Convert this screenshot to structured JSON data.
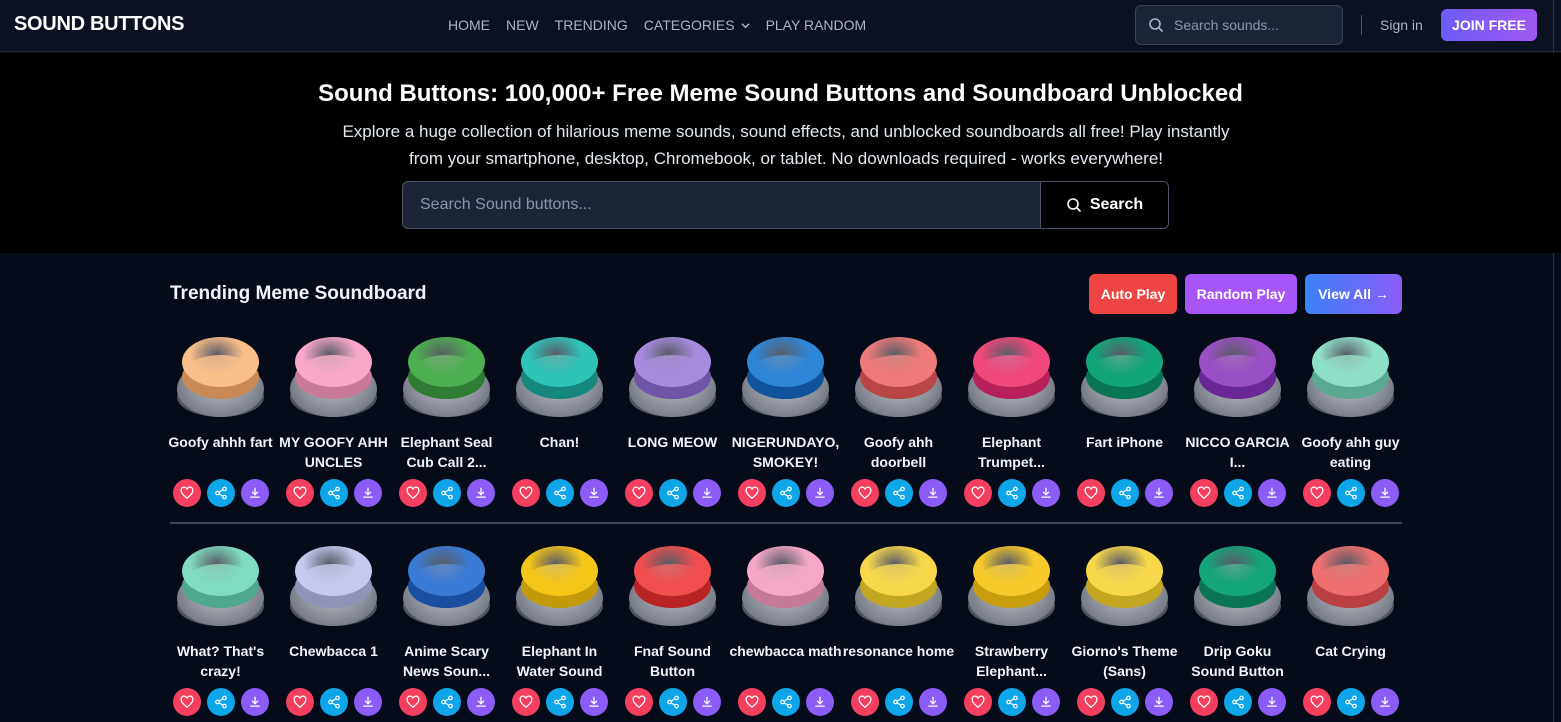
{
  "header": {
    "logo": "SOUND BUTTONS",
    "nav": [
      {
        "label": "HOME"
      },
      {
        "label": "NEW"
      },
      {
        "label": "TRENDING"
      },
      {
        "label": "CATEGORIES"
      },
      {
        "label": "PLAY RANDOM"
      }
    ],
    "search_placeholder": "Search sounds...",
    "sign_in": "Sign in",
    "join": "JOIN FREE"
  },
  "hero": {
    "title": "Sound Buttons: 100,000+ Free Meme Sound Buttons and Soundboard Unblocked",
    "description": "Explore a huge collection of hilarious meme sounds, sound effects, and unblocked soundboards all free! Play instantly from your smartphone, desktop, Chromebook, or tablet. No downloads required - works everywhere!",
    "search_placeholder": "Search Sound buttons...",
    "search_button": "Search"
  },
  "section": {
    "title": "Trending Meme Soundboard",
    "auto_play": "Auto Play",
    "random_play": "Random Play",
    "view_all": "View All →"
  },
  "rows": [
    [
      {
        "label": "Goofy ahhh fart",
        "color": "#fbbf8a",
        "dark": "#c98a55"
      },
      {
        "label": "MY GOOFY AHH UNCLES",
        "color": "#f9a8c9",
        "dark": "#c97a98"
      },
      {
        "label": "Elephant Seal Cub Call 2...",
        "color": "#4caf50",
        "dark": "#2e7d32"
      },
      {
        "label": "Chan!",
        "color": "#2ec4b6",
        "dark": "#15877c"
      },
      {
        "label": "LONG MEOW",
        "color": "#a78bdf",
        "dark": "#6e55a8"
      },
      {
        "label": "NIGERUNDAYO, SMOKEY!",
        "color": "#2f86d6",
        "dark": "#10539a"
      },
      {
        "label": "Goofy ahh doorbell",
        "color": "#ef7a7a",
        "dark": "#b84646"
      },
      {
        "label": "Elephant Trumpet...",
        "color": "#f0487a",
        "dark": "#b8205a"
      },
      {
        "label": "Fart iPhone",
        "color": "#12a57a",
        "dark": "#0a7555"
      },
      {
        "label": "NICCO GARCIA I...",
        "color": "#9b4fc4",
        "dark": "#6a2896"
      },
      {
        "label": "Goofy ahh guy eating",
        "color": "#8fe0c8",
        "dark": "#5aa892"
      }
    ],
    [
      {
        "label": "What? That's crazy!",
        "color": "#7fdcc0",
        "dark": "#4fa88e"
      },
      {
        "label": "Chewbacca 1",
        "color": "#c5c9ec",
        "dark": "#9095b8"
      },
      {
        "label": "Anime Scary News Soun...",
        "color": "#3a7bd5",
        "dark": "#1a4fa0"
      },
      {
        "label": "Elephant In Water Sound",
        "color": "#f5c518",
        "dark": "#c49a0a"
      },
      {
        "label": "Fnaf Sound Button",
        "color": "#f24e4e",
        "dark": "#b82424"
      },
      {
        "label": "chewbacca math",
        "color": "#f7a8c8",
        "dark": "#c57a97"
      },
      {
        "label": "resonance home",
        "color": "#f8d84a",
        "dark": "#c4a720"
      },
      {
        "label": "Strawberry Elephant...",
        "color": "#f7c92a",
        "dark": "#c79d0e"
      },
      {
        "label": "Giorno's Theme (Sans)",
        "color": "#f8d84a",
        "dark": "#c4a720"
      },
      {
        "label": "Drip Goku Sound Button",
        "color": "#14a57a",
        "dark": "#0b7455"
      },
      {
        "label": "Cat Crying",
        "color": "#ef6f6f",
        "dark": "#b84040"
      }
    ]
  ]
}
